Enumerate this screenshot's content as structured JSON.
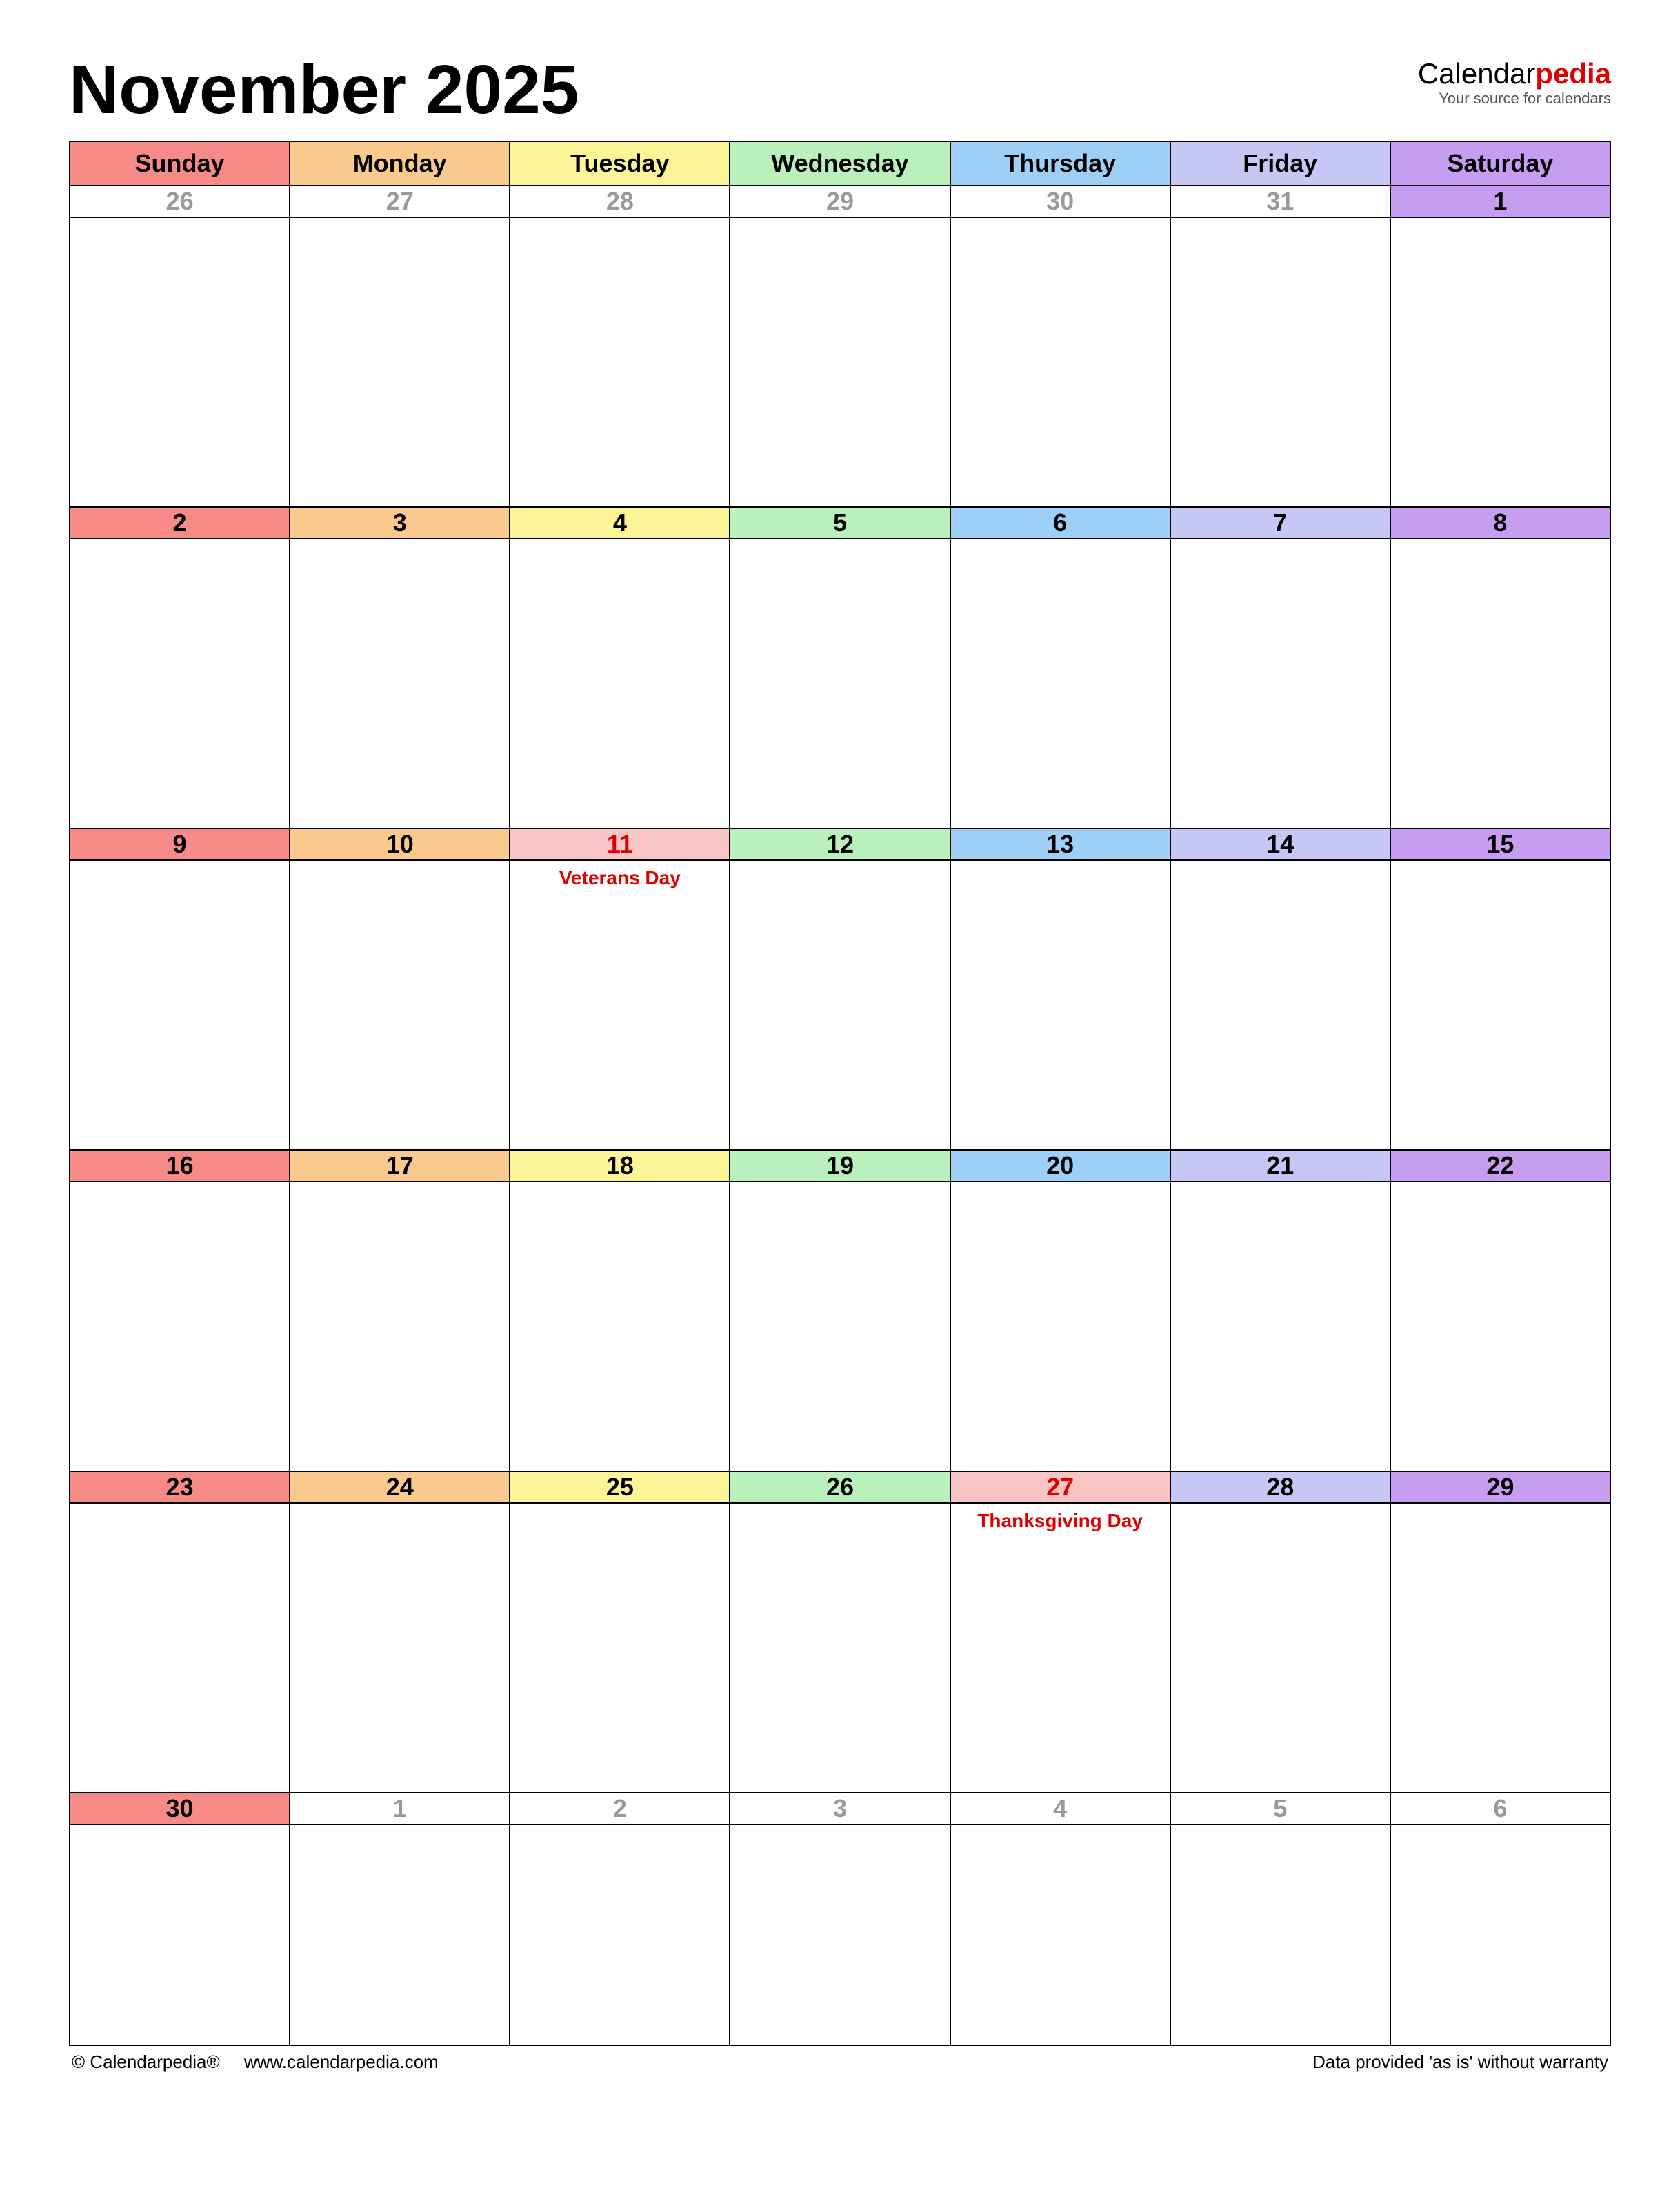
{
  "header": {
    "title": "November 2025",
    "brand_prefix": "Calendar",
    "brand_accent": "pedia",
    "brand_tagline": "Your source for calendars"
  },
  "days_of_week": [
    "Sunday",
    "Monday",
    "Tuesday",
    "Wednesday",
    "Thursday",
    "Friday",
    "Saturday"
  ],
  "colors": {
    "sun": "#f58a87",
    "mon": "#fac98e",
    "tue": "#fbf598",
    "wed": "#b9f0bb",
    "thu": "#9ecff7",
    "fri": "#c7c7f5",
    "sat": "#c79df2",
    "holiday_bg": "#f9c5c4",
    "holiday_text": "#d00"
  },
  "weeks": [
    [
      {
        "n": "26",
        "out": true
      },
      {
        "n": "27",
        "out": true
      },
      {
        "n": "28",
        "out": true
      },
      {
        "n": "29",
        "out": true
      },
      {
        "n": "30",
        "out": true
      },
      {
        "n": "31",
        "out": true
      },
      {
        "n": "1"
      }
    ],
    [
      {
        "n": "2"
      },
      {
        "n": "3"
      },
      {
        "n": "4"
      },
      {
        "n": "5"
      },
      {
        "n": "6"
      },
      {
        "n": "7"
      },
      {
        "n": "8"
      }
    ],
    [
      {
        "n": "9"
      },
      {
        "n": "10"
      },
      {
        "n": "11",
        "holiday": "Veterans Day"
      },
      {
        "n": "12"
      },
      {
        "n": "13"
      },
      {
        "n": "14"
      },
      {
        "n": "15"
      }
    ],
    [
      {
        "n": "16"
      },
      {
        "n": "17"
      },
      {
        "n": "18"
      },
      {
        "n": "19"
      },
      {
        "n": "20"
      },
      {
        "n": "21"
      },
      {
        "n": "22"
      }
    ],
    [
      {
        "n": "23"
      },
      {
        "n": "24"
      },
      {
        "n": "25"
      },
      {
        "n": "26"
      },
      {
        "n": "27",
        "holiday": "Thanksgiving Day"
      },
      {
        "n": "28"
      },
      {
        "n": "29"
      }
    ],
    [
      {
        "n": "30"
      },
      {
        "n": "1",
        "out": true
      },
      {
        "n": "2",
        "out": true
      },
      {
        "n": "3",
        "out": true
      },
      {
        "n": "4",
        "out": true
      },
      {
        "n": "5",
        "out": true
      },
      {
        "n": "6",
        "out": true
      }
    ]
  ],
  "footer": {
    "copyright": "© Calendarpedia®",
    "url": "www.calendarpedia.com",
    "disclaimer": "Data provided 'as is' without warranty"
  }
}
